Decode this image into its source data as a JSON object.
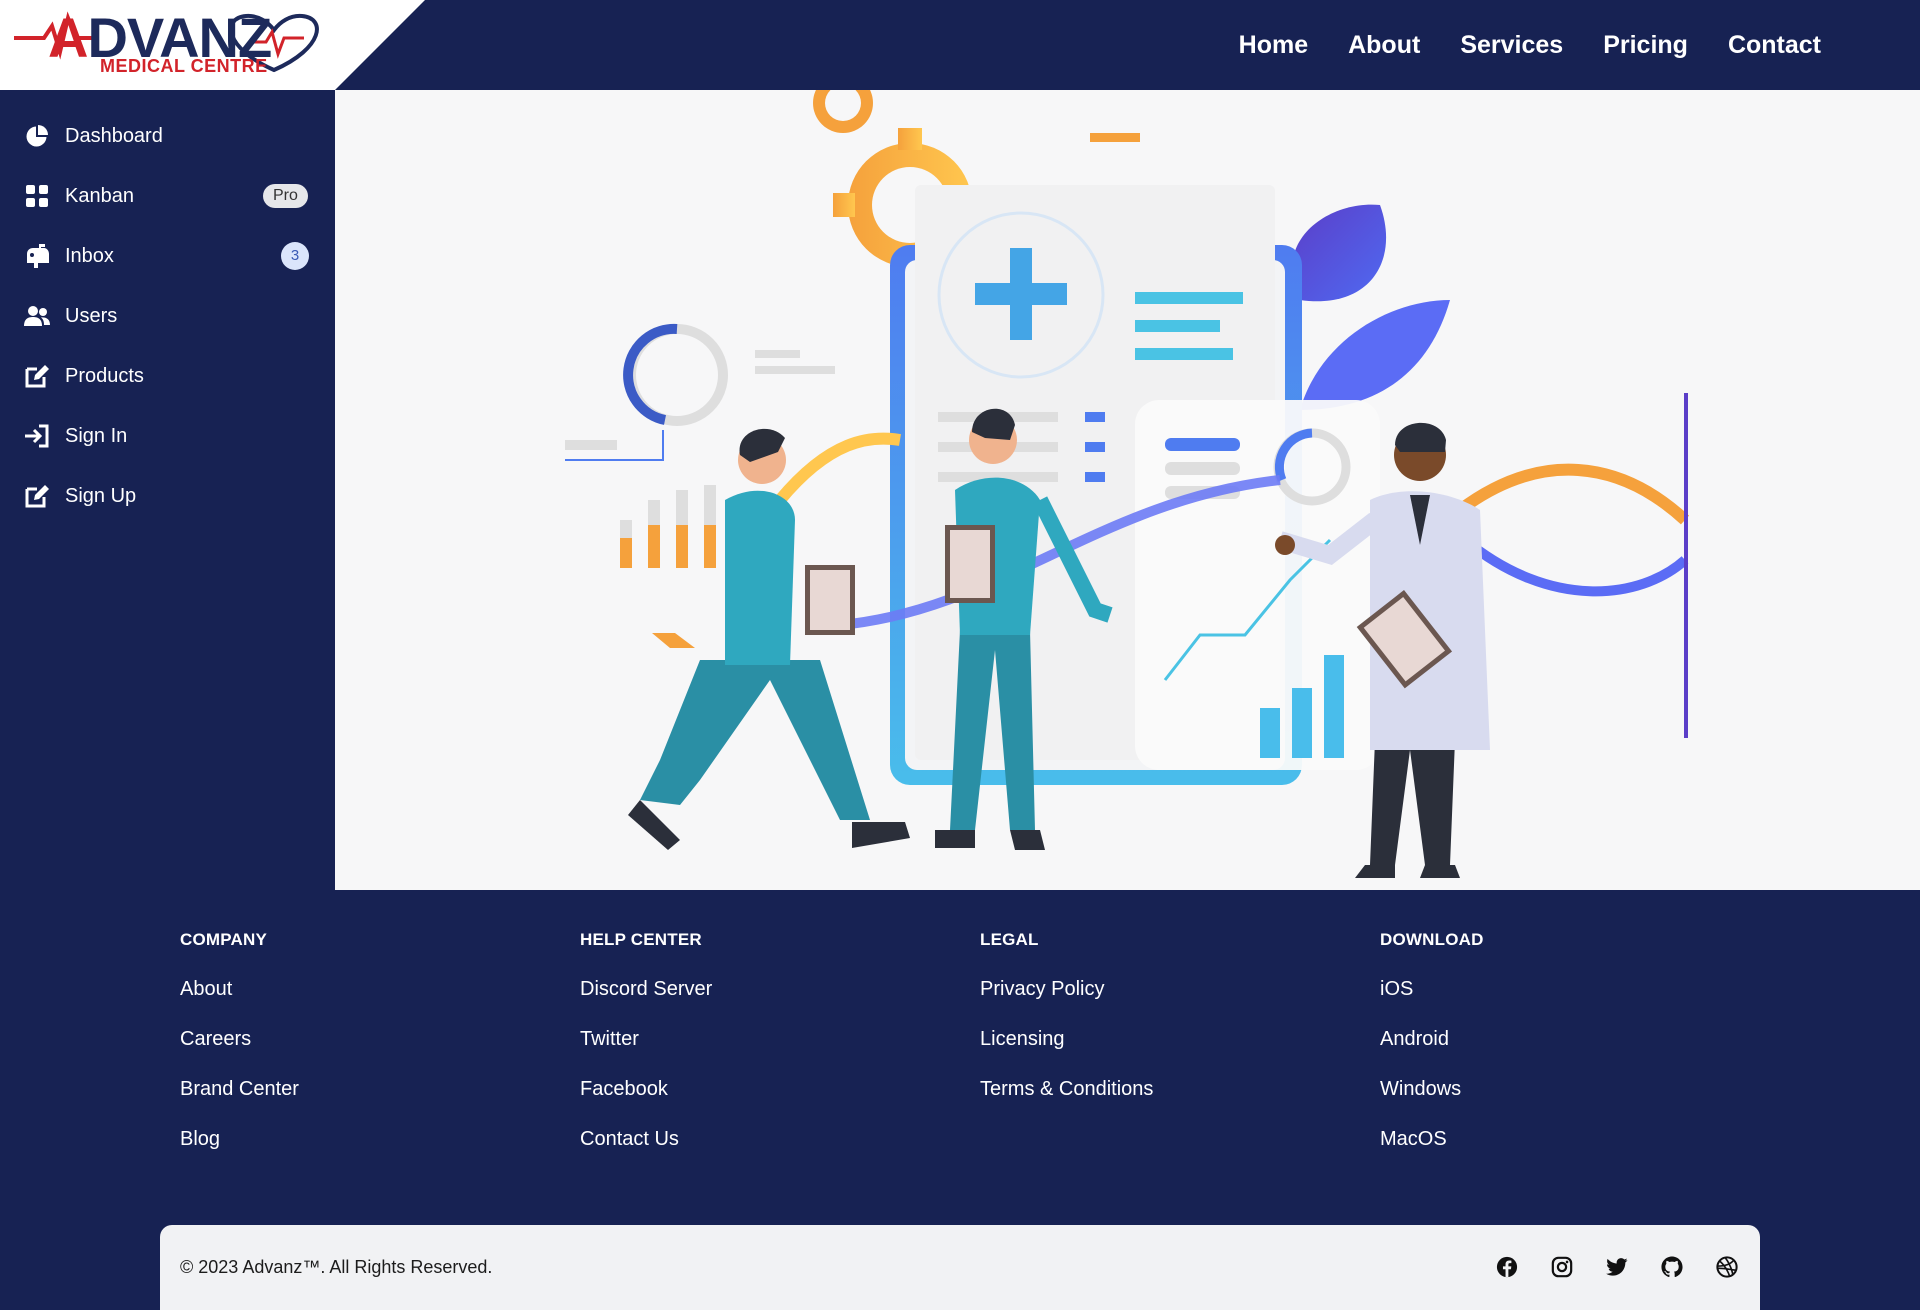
{
  "logo": {
    "word_prefix": "A",
    "word_rest": "DVANZ",
    "subtitle": "MEDICAL CENTRE"
  },
  "topnav": {
    "items": [
      "Home",
      "About",
      "Services",
      "Pricing",
      "Contact"
    ]
  },
  "sidebar": {
    "items": [
      {
        "label": "Dashboard",
        "icon": "pie-chart-icon"
      },
      {
        "label": "Kanban",
        "icon": "grid-icon",
        "badge": "Pro"
      },
      {
        "label": "Inbox",
        "icon": "mailbox-icon",
        "badge": "3"
      },
      {
        "label": "Users",
        "icon": "users-icon"
      },
      {
        "label": "Products",
        "icon": "edit-icon"
      },
      {
        "label": "Sign In",
        "icon": "sign-in-icon"
      },
      {
        "label": "Sign Up",
        "icon": "edit-icon"
      }
    ]
  },
  "footer": {
    "columns": [
      {
        "heading": "COMPANY",
        "links": [
          "About",
          "Careers",
          "Brand Center",
          "Blog"
        ]
      },
      {
        "heading": "HELP CENTER",
        "links": [
          "Discord Server",
          "Twitter",
          "Facebook",
          "Contact Us"
        ]
      },
      {
        "heading": "LEGAL",
        "links": [
          "Privacy Policy",
          "Licensing",
          "Terms & Conditions"
        ]
      },
      {
        "heading": "DOWNLOAD",
        "links": [
          "iOS",
          "Android",
          "Windows",
          "MacOS"
        ]
      }
    ],
    "copyright": "© 2023 Advanz™. All Rights Reserved.",
    "social": [
      "facebook-icon",
      "instagram-icon",
      "twitter-icon",
      "github-icon",
      "dribbble-icon"
    ]
  },
  "colors": {
    "navy": "#172253",
    "brand_red": "#d2232a",
    "hero_bg": "#f7f7f8"
  }
}
